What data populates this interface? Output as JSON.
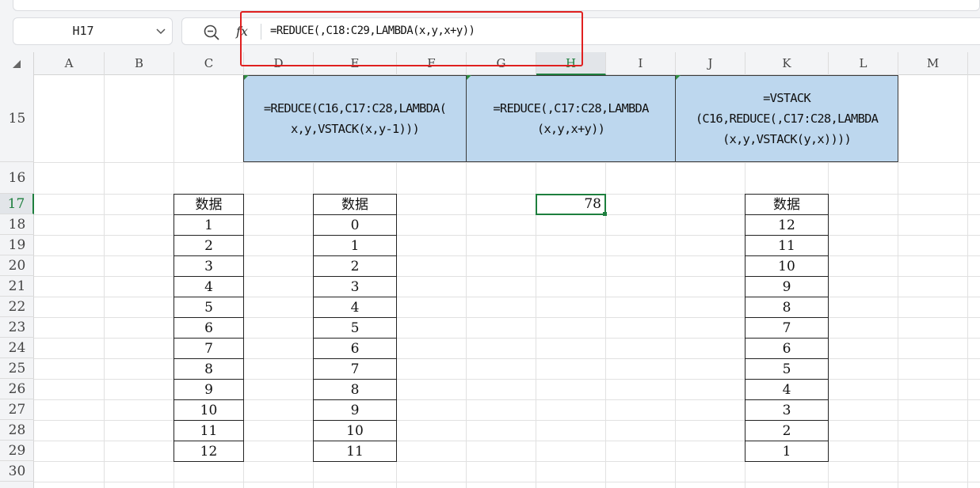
{
  "name_box": {
    "value": "H17"
  },
  "formula_bar": {
    "formula": "=REDUCE(,C18:C29,LAMBDA(x,y,x+y))"
  },
  "columns": [
    "A",
    "B",
    "C",
    "D",
    "E",
    "F",
    "G",
    "H",
    "I",
    "J",
    "K",
    "L",
    "M"
  ],
  "rows": [
    "15",
    "16",
    "17",
    "18",
    "19",
    "20",
    "21",
    "22",
    "23",
    "24",
    "25",
    "26",
    "27",
    "28",
    "29",
    "30"
  ],
  "active_cell": {
    "ref": "H17",
    "column": "H",
    "row": "17",
    "value": "78"
  },
  "formula_cells": {
    "d15": "=REDUCE(C16,C17:C28,LAMBDA(\nx,y,VSTACK(x,y-1)))",
    "g15": "=REDUCE(,C17:C28,LAMBDA\n(x,y,x+y))",
    "j15": "=VSTACK\n(C16,REDUCE(,C17:C28,LAMBDA\n(x,y,VSTACK(y,x))))"
  },
  "table_c": {
    "header": "数据",
    "values": [
      "1",
      "2",
      "3",
      "4",
      "5",
      "6",
      "7",
      "8",
      "9",
      "10",
      "11",
      "12"
    ]
  },
  "table_e": {
    "header": "数据",
    "values": [
      "0",
      "1",
      "2",
      "3",
      "4",
      "5",
      "6",
      "7",
      "8",
      "9",
      "10",
      "11"
    ]
  },
  "table_k": {
    "header": "数据",
    "values": [
      "12",
      "11",
      "10",
      "9",
      "8",
      "7",
      "6",
      "5",
      "4",
      "3",
      "2",
      "1"
    ]
  },
  "colors": {
    "selection": "#1e7f3e",
    "formula_fill": "#bdd7ee",
    "highlight": "#e02020"
  },
  "icons": [
    "zoom-icon",
    "fx-icon",
    "chevron-down-icon",
    "select-all-icon"
  ]
}
